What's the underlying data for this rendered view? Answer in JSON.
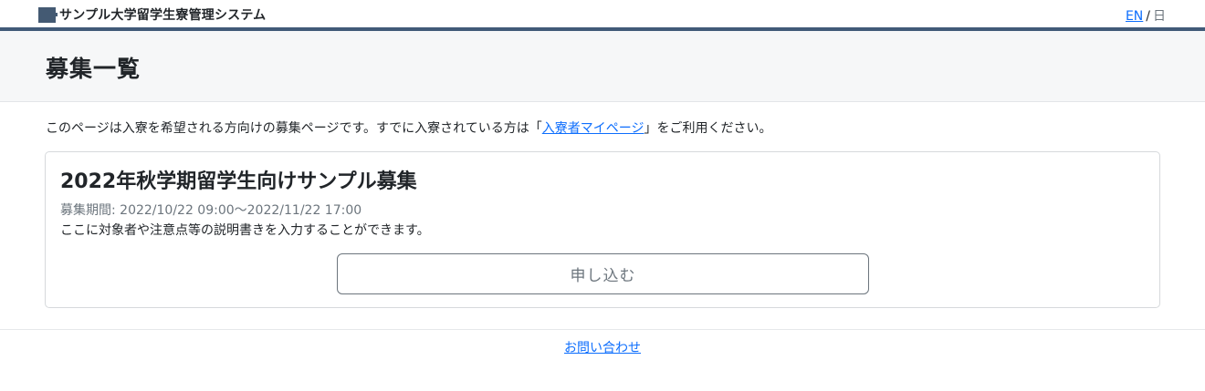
{
  "header": {
    "brand_name": "サンプル大学留学生寮管理システム",
    "lang_en": "EN",
    "lang_sep": "/",
    "lang_ja": "日"
  },
  "page": {
    "title": "募集一覧"
  },
  "notice": {
    "before": "このページは入寮を希望される方向けの募集ページです。すでに入寮されている方は「",
    "link": "入寮者マイページ",
    "after": "」をご利用ください。"
  },
  "recruitment": {
    "title": "2022年秋学期留学生向けサンプル募集",
    "period_label": "募集期間: 2022/10/22 09:00〜2022/11/22 17:00",
    "description": "ここに対象者や注意点等の説明書きを入力することができます。",
    "apply_label": "申し込む"
  },
  "footer": {
    "contact_label": "お問い合わせ"
  },
  "colors": {
    "accent": "#415a78",
    "link": "#0d6efd",
    "header_bg": "#f6f7f8"
  },
  "icons": {
    "brand_logo": "university-logo-icon"
  }
}
